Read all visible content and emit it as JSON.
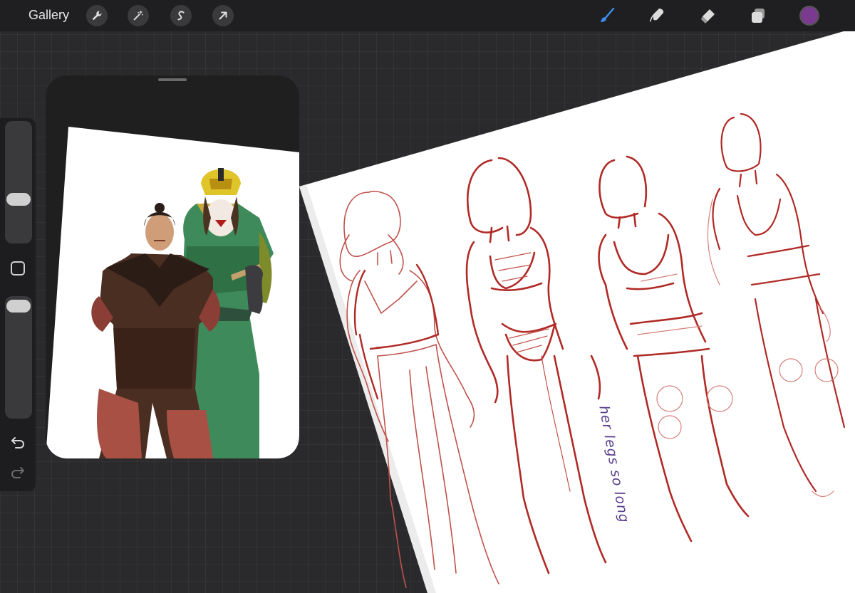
{
  "topbar": {
    "gallery_label": "Gallery",
    "left_tools": [
      "wrench-icon",
      "magic-wand-icon",
      "selection-s-icon",
      "transform-arrow-icon"
    ],
    "right_tools": [
      "brush-icon",
      "smudge-icon",
      "eraser-icon",
      "layers-icon"
    ],
    "active_tool": "brush-icon",
    "active_tool_color": "#3f8ff0",
    "current_color": "#7a3a8f"
  },
  "sidebar": {
    "brush_size_level": 0.62,
    "opacity_level": 0.0,
    "modify_icon": "square-icon",
    "undo_icon": "undo-icon",
    "redo_icon": "redo-icon"
  },
  "reference_panel": {
    "title": ""
  },
  "canvas": {
    "handwritten_note": "her legs so long",
    "sketch_color": "#b02a26"
  }
}
